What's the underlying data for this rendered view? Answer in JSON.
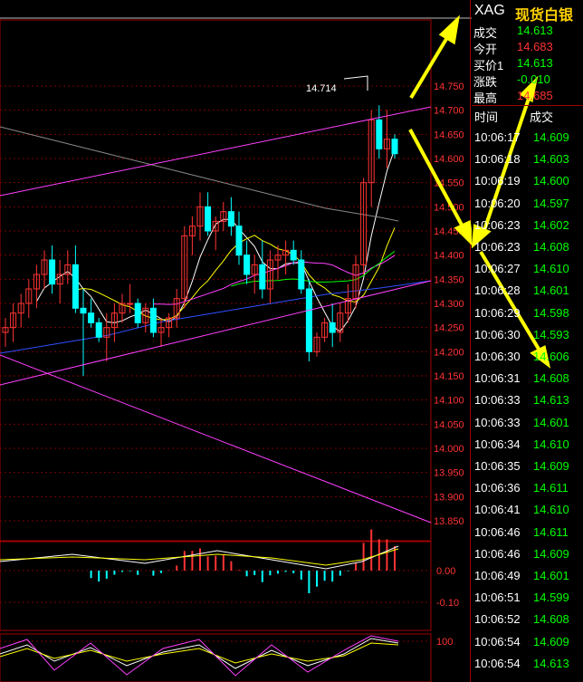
{
  "chart": {
    "y_axis_labels": [
      "14.750",
      "14.700",
      "14.650",
      "14.600",
      "14.550",
      "14.500",
      "14.450",
      "14.400",
      "14.350",
      "14.300",
      "14.250",
      "14.200",
      "14.150",
      "14.100",
      "14.050",
      "14.000",
      "13.950",
      "13.900",
      "13.850"
    ],
    "high_annotation": "14.714",
    "macd_axis_labels": [
      "0.00",
      "-0.10"
    ],
    "kdj_axis_labels": [
      "100"
    ]
  },
  "quote_panel": {
    "symbol": "XAG",
    "name": "现货白银",
    "rows": [
      {
        "label": "成交",
        "value": "14.613",
        "color": "green"
      },
      {
        "label": "今开",
        "value": "14.683",
        "color": "red"
      },
      {
        "label": "买价1",
        "value": "14.613",
        "color": "green"
      },
      {
        "label": "涨跌",
        "value": "-0.010",
        "color": "green"
      },
      {
        "label": "最高",
        "value": "14.685",
        "color": "red"
      }
    ]
  },
  "tick_list": {
    "header_time": "时间",
    "header_price": "成交",
    "rows": [
      {
        "time": "10:06:17",
        "price": "14.609"
      },
      {
        "time": "10:06:18",
        "price": "14.603"
      },
      {
        "time": "10:06:19",
        "price": "14.600"
      },
      {
        "time": "10:06:20",
        "price": "14.597"
      },
      {
        "time": "10:06:23",
        "price": "14.602"
      },
      {
        "time": "10:06:23",
        "price": "14.608"
      },
      {
        "time": "10:06:27",
        "price": "14.610"
      },
      {
        "time": "10:06:28",
        "price": "14.601"
      },
      {
        "time": "10:06:29",
        "price": "14.598"
      },
      {
        "time": "10:06:30",
        "price": "14.593"
      },
      {
        "time": "10:06:30",
        "price": "14.606"
      },
      {
        "time": "10:06:31",
        "price": "14.608"
      },
      {
        "time": "10:06:33",
        "price": "14.613"
      },
      {
        "time": "10:06:33",
        "price": "14.601"
      },
      {
        "time": "10:06:34",
        "price": "14.610"
      },
      {
        "time": "10:06:35",
        "price": "14.609"
      },
      {
        "time": "10:06:36",
        "price": "14.611"
      },
      {
        "time": "10:06:41",
        "price": "14.610"
      },
      {
        "time": "10:06:46",
        "price": "14.611"
      },
      {
        "time": "10:06:46",
        "price": "14.609"
      },
      {
        "time": "10:06:49",
        "price": "14.601"
      },
      {
        "time": "10:06:51",
        "price": "14.599"
      },
      {
        "time": "10:06:52",
        "price": "14.608"
      },
      {
        "time": "10:06:54",
        "price": "14.609"
      },
      {
        "time": "10:06:54",
        "price": "14.613"
      }
    ]
  },
  "colors": {
    "up": "#ff3333",
    "down": "#00ffff",
    "grid": "#800000",
    "panel_border": "#a00000",
    "annotation_arrow": "#ffff00"
  }
}
